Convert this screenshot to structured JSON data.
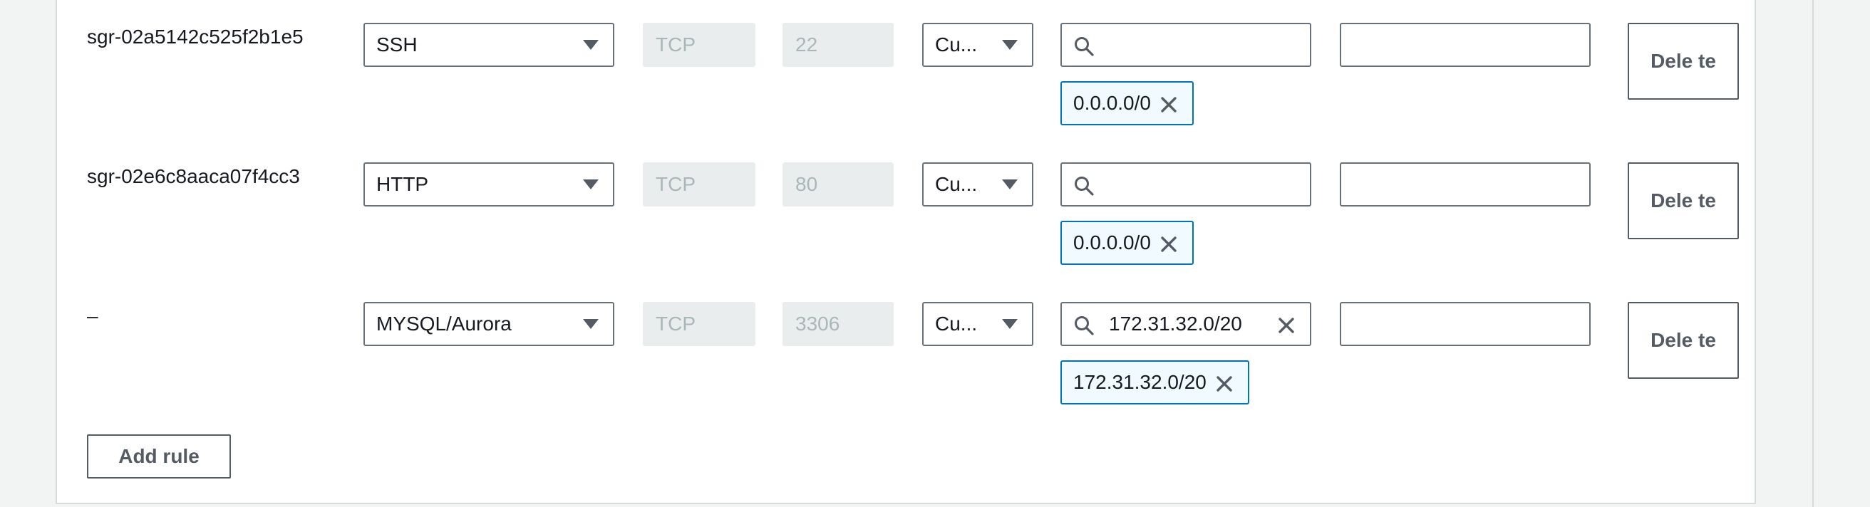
{
  "rules": [
    {
      "id": "sgr-02a5142c525f2b1e5",
      "type": "SSH",
      "protocol": "TCP",
      "port_range": "22",
      "source_type": "Cu...",
      "source_search_value": "",
      "source_tokens": [
        "0.0.0.0/0"
      ],
      "description": "",
      "delete_label": "Dele te"
    },
    {
      "id": "sgr-02e6c8aaca07f4cc3",
      "type": "HTTP",
      "protocol": "TCP",
      "port_range": "80",
      "source_type": "Cu...",
      "source_search_value": "",
      "source_tokens": [
        "0.0.0.0/0"
      ],
      "description": "",
      "delete_label": "Dele te"
    },
    {
      "id": "–",
      "type": "MYSQL/Aurora",
      "protocol": "TCP",
      "port_range": "3306",
      "source_type": "Cu...",
      "source_search_value": "172.31.32.0/20",
      "source_tokens": [
        "172.31.32.0/20"
      ],
      "description": "",
      "delete_label": "Dele te"
    }
  ],
  "add_rule_label": "Add rule",
  "icons": {
    "dropdown": "caret-down-icon",
    "search": "search-icon",
    "remove": "close-icon"
  }
}
